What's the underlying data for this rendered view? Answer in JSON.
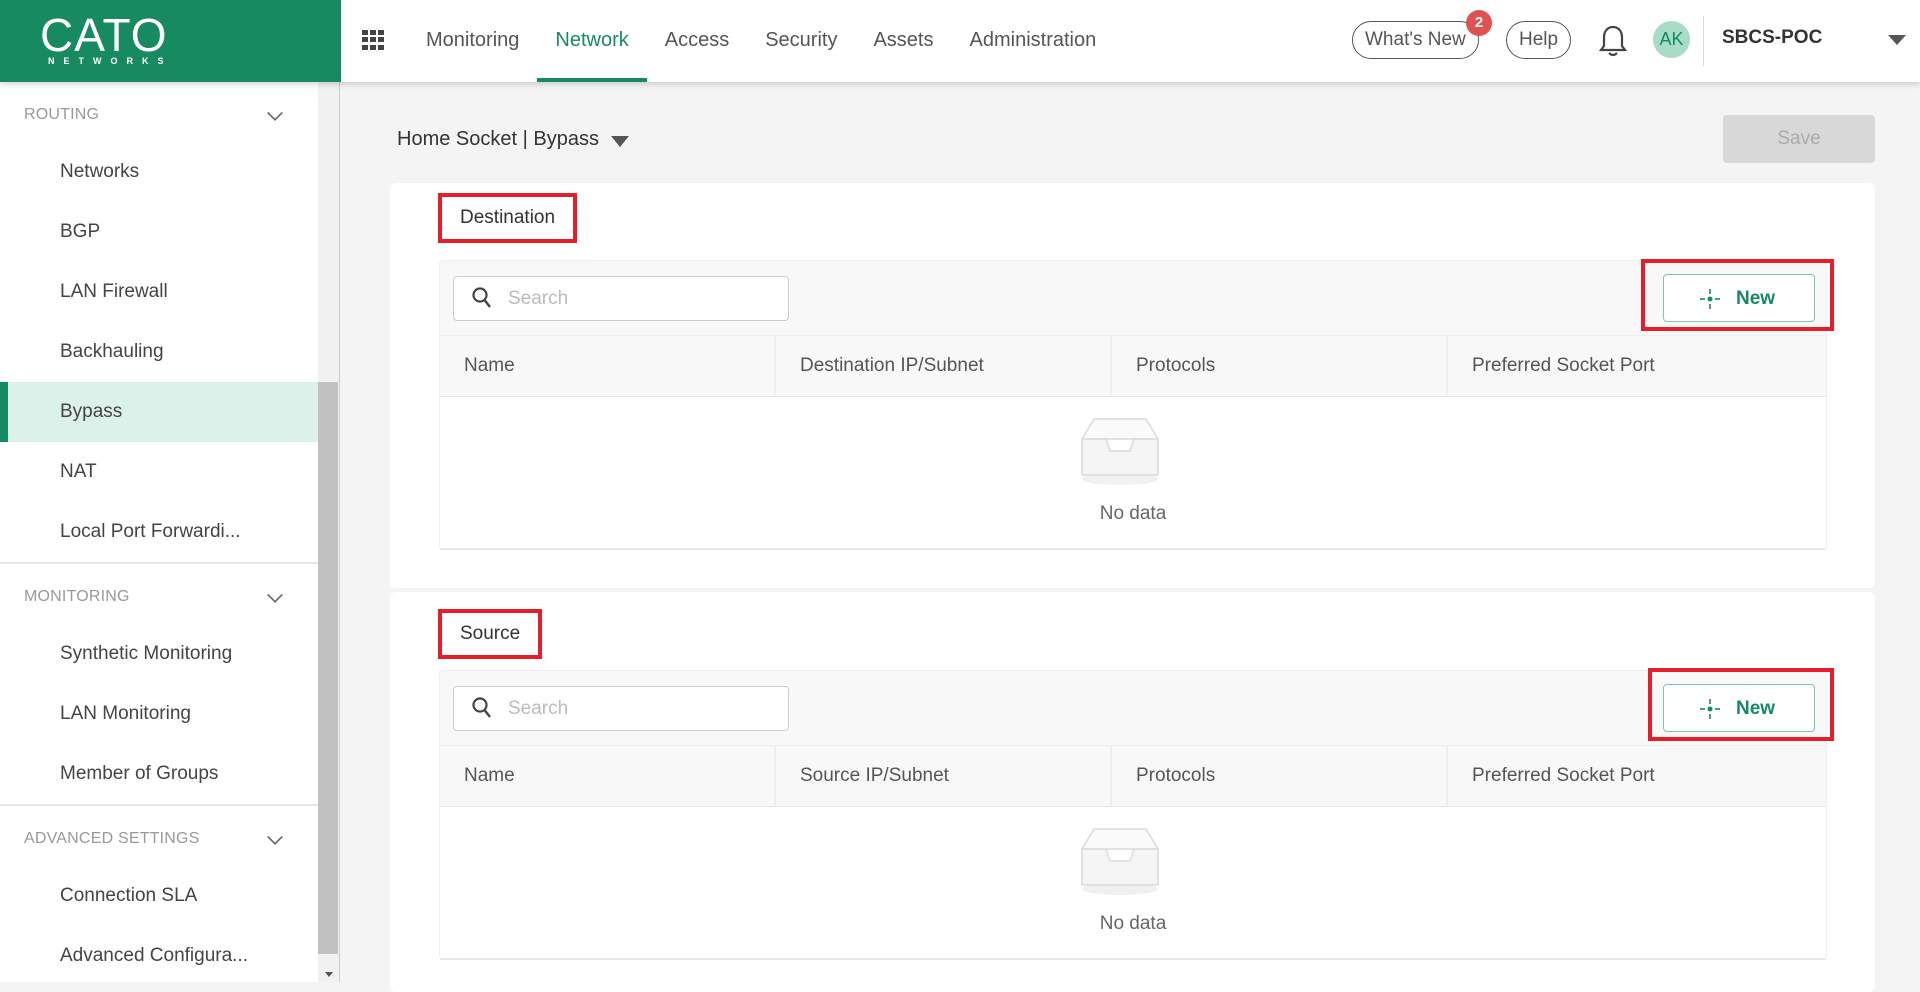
{
  "brand": {
    "logo_text": "CATO",
    "logo_subtext": "NETWORKS",
    "color": "#178a62"
  },
  "topnav": {
    "items": [
      {
        "label": "Monitoring",
        "active": false
      },
      {
        "label": "Network",
        "active": true
      },
      {
        "label": "Access",
        "active": false
      },
      {
        "label": "Security",
        "active": false
      },
      {
        "label": "Assets",
        "active": false
      },
      {
        "label": "Administration",
        "active": false
      }
    ],
    "whats_new_label": "What's New",
    "whats_new_badge": "2",
    "help_label": "Help",
    "avatar_initials": "AK",
    "account_name": "SBCS-POC"
  },
  "sidebar": {
    "sections": [
      {
        "label": "ROUTING",
        "items": [
          "Networks",
          "BGP",
          "LAN Firewall",
          "Backhauling",
          "Bypass",
          "NAT",
          "Local Port Forwardi..."
        ]
      },
      {
        "label": "MONITORING",
        "items": [
          "Synthetic Monitoring",
          "LAN Monitoring",
          "Member of Groups"
        ]
      },
      {
        "label": "ADVANCED SETTINGS",
        "items": [
          "Connection SLA",
          "Advanced Configura..."
        ]
      }
    ],
    "active_item": "Bypass"
  },
  "main": {
    "breadcrumb": "Home Socket | Bypass",
    "save_label": "Save",
    "destination": {
      "title": "Destination",
      "search_placeholder": "Search",
      "new_label": "New",
      "columns": [
        "Name",
        "Destination IP/Subnet",
        "Protocols",
        "Preferred Socket Port"
      ],
      "empty_text": "No data"
    },
    "source": {
      "title": "Source",
      "search_placeholder": "Search",
      "new_label": "New",
      "columns": [
        "Name",
        "Source IP/Subnet",
        "Protocols",
        "Preferred Socket Port"
      ],
      "empty_text": "No data"
    }
  }
}
